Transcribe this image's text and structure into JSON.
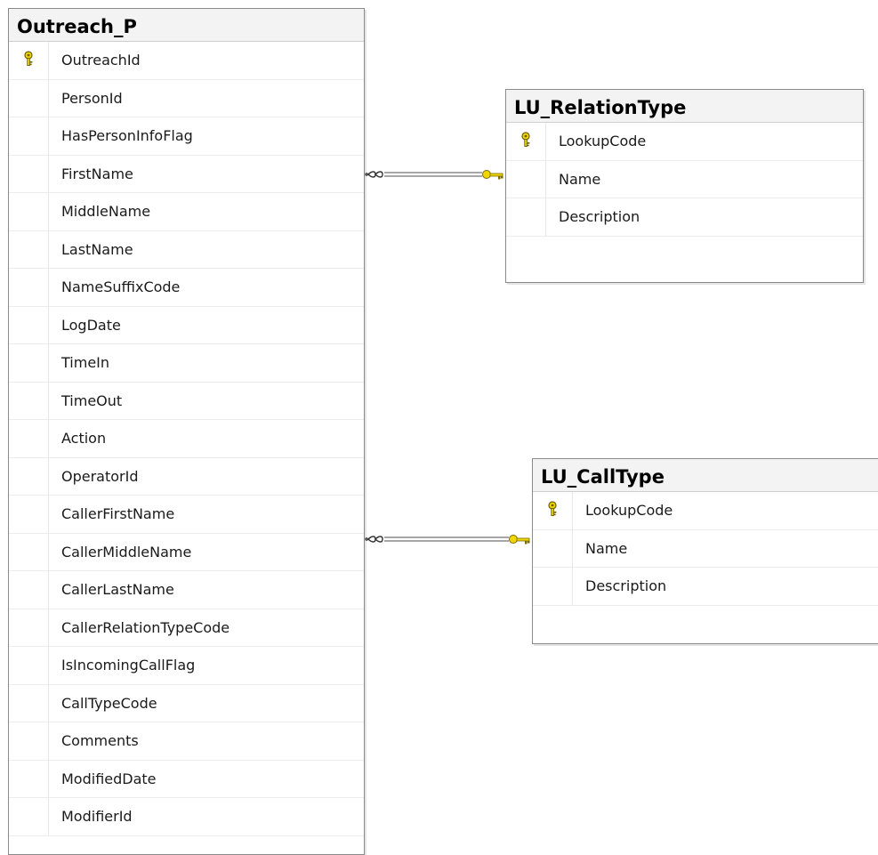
{
  "tables": {
    "outreach": {
      "title": "Outreach_P",
      "columns": [
        {
          "name": "OutreachId",
          "primary_key": true
        },
        {
          "name": "PersonId",
          "primary_key": false
        },
        {
          "name": "HasPersonInfoFlag",
          "primary_key": false
        },
        {
          "name": "FirstName",
          "primary_key": false
        },
        {
          "name": "MiddleName",
          "primary_key": false
        },
        {
          "name": "LastName",
          "primary_key": false
        },
        {
          "name": "NameSuffixCode",
          "primary_key": false
        },
        {
          "name": "LogDate",
          "primary_key": false
        },
        {
          "name": "TimeIn",
          "primary_key": false
        },
        {
          "name": "TimeOut",
          "primary_key": false
        },
        {
          "name": "Action",
          "primary_key": false
        },
        {
          "name": "OperatorId",
          "primary_key": false
        },
        {
          "name": "CallerFirstName",
          "primary_key": false
        },
        {
          "name": "CallerMiddleName",
          "primary_key": false
        },
        {
          "name": "CallerLastName",
          "primary_key": false
        },
        {
          "name": "CallerRelationTypeCode",
          "primary_key": false
        },
        {
          "name": "IsIncomingCallFlag",
          "primary_key": false
        },
        {
          "name": "CallTypeCode",
          "primary_key": false
        },
        {
          "name": "Comments",
          "primary_key": false
        },
        {
          "name": "ModifiedDate",
          "primary_key": false
        },
        {
          "name": "ModifierId",
          "primary_key": false
        }
      ]
    },
    "relation_type": {
      "title": "LU_RelationType",
      "columns": [
        {
          "name": "LookupCode",
          "primary_key": true
        },
        {
          "name": "Name",
          "primary_key": false
        },
        {
          "name": "Description",
          "primary_key": false
        }
      ]
    },
    "call_type": {
      "title": "LU_CallType",
      "columns": [
        {
          "name": "LookupCode",
          "primary_key": true
        },
        {
          "name": "Name",
          "primary_key": false
        },
        {
          "name": "Description",
          "primary_key": false
        }
      ]
    }
  },
  "relationships": [
    {
      "from": "Outreach_P",
      "to": "LU_RelationType",
      "from_end": "many",
      "to_end": "one"
    },
    {
      "from": "Outreach_P",
      "to": "LU_CallType",
      "from_end": "many",
      "to_end": "one"
    }
  ],
  "colors": {
    "key_icon": "#e8c700",
    "connector": "#7a7a7a",
    "header_bg": "#f3f3f3"
  },
  "icons": {
    "primary_key": "key-icon",
    "many_end": "infinity-icon",
    "one_end": "key-icon"
  }
}
